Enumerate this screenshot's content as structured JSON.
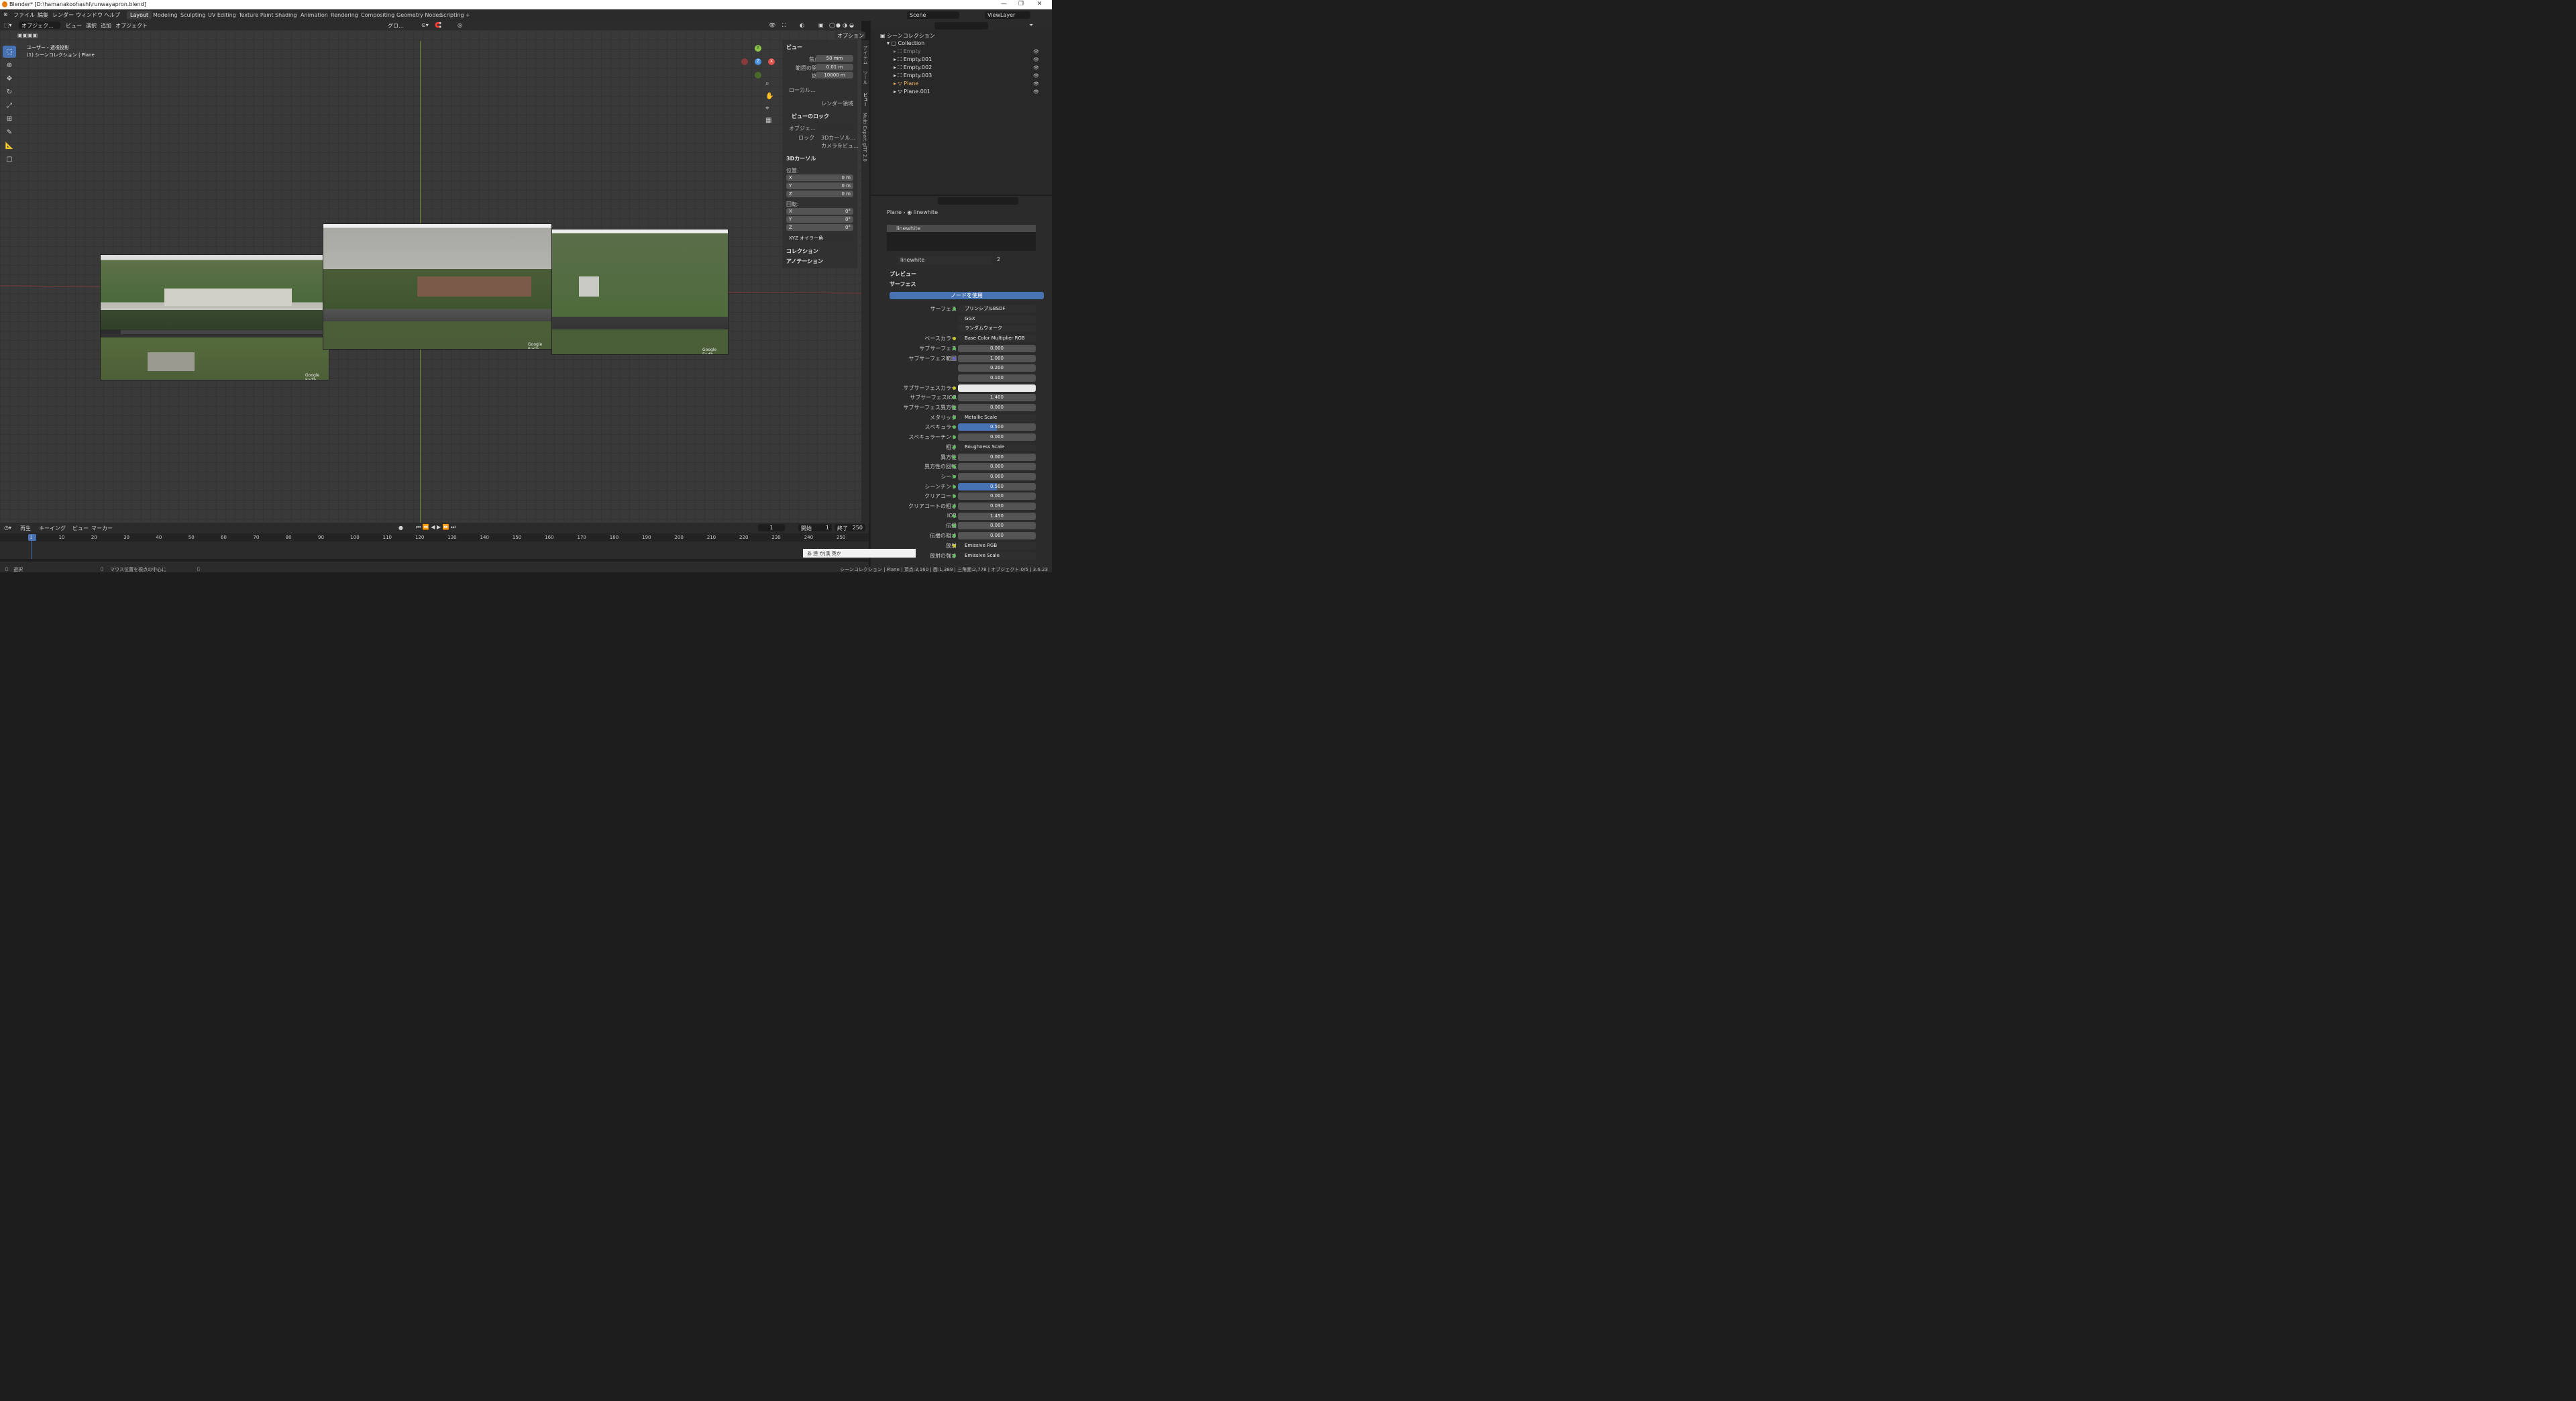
{
  "window": {
    "title": "Blender* [D:\\hamanakoohashi\\runwayapron.blend]"
  },
  "menu": [
    "ファイル",
    "編集",
    "レンダー",
    "ウィンドウ",
    "ヘルプ"
  ],
  "workspaces": [
    "Layout",
    "Modeling",
    "Sculpting",
    "UV Editing",
    "Texture Paint",
    "Shading",
    "Animation",
    "Rendering",
    "Compositing",
    "Geometry Nodes",
    "Scripting"
  ],
  "active_workspace": "Layout",
  "scene": "Scene",
  "viewlayer": "ViewLayer",
  "viewport_header": {
    "mode": "オブジェク…",
    "view": "ビュー",
    "select": "選択",
    "add": "追加",
    "object": "オブジェクト",
    "transform": "グロ…",
    "options": "オプション"
  },
  "viewport": {
    "title": "ユーザー・透視投影",
    "subtitle": "(1) シーンコレクション | Plane",
    "watermark": "Google Earth"
  },
  "npanel": {
    "view_header": "ビュー",
    "focal_label": "焦点距離",
    "focal": "50 mm",
    "clip_start_label": "範囲の開始",
    "clip_start": "0.01 m",
    "clip_end_label": "終了",
    "clip_end": "10000 m",
    "local_label": "ローカル…",
    "render_region": "レンダー領域",
    "view_lock": "ビューのロック",
    "lock_object": "オブジェ…",
    "lock_label": "ロック",
    "lock_cursor": "3Dカーソル…",
    "lock_camera": "カメラをビュ…",
    "cursor_header": "3Dカーソル",
    "location": "位置:",
    "x": "X",
    "y": "Y",
    "z": "Z",
    "loc_x": "0 m",
    "loc_y": "0 m",
    "loc_z": "0 m",
    "rotation": "回転:",
    "rot_x": "0°",
    "rot_y": "0°",
    "rot_z": "0°",
    "euler": "XYZ オイラー角",
    "collection": "コレクション",
    "annotation": "アノテーション"
  },
  "side_tabs": [
    "アイテム",
    "ツール",
    "ビュー",
    "Multi-Export glTF 2.0"
  ],
  "outliner": {
    "root": "シーンコレクション",
    "collection": "Collection",
    "items": [
      "Empty",
      "Empty.001",
      "Empty.002",
      "Empty.003",
      "Plane",
      "Plane.001"
    ]
  },
  "properties": {
    "breadcrumb_obj": "Plane",
    "breadcrumb_mat": "linewhite",
    "slot": "linewhite",
    "material": "linewhite",
    "users": "2",
    "preview": "プレビュー",
    "surface": "サーフェス",
    "use_nodes": "ノードを使用",
    "rows": [
      {
        "label": "サーフェス",
        "value": "プリンシプルBSDF",
        "kind": "link",
        "dot": "g"
      },
      {
        "label": "",
        "value": "GGX",
        "kind": "enum"
      },
      {
        "label": "",
        "value": "ランダムウォーク",
        "kind": "enum"
      },
      {
        "label": "ベースカラー",
        "value": "Base Color Multiplier RGB",
        "kind": "link",
        "dot": "y"
      },
      {
        "label": "サブサーフェス",
        "value": "0.000",
        "kind": "num",
        "dot": "g"
      },
      {
        "label": "サブサーフェス範囲",
        "value": "1.000",
        "kind": "num",
        "dot": "b"
      },
      {
        "label": "",
        "value": "0.200",
        "kind": "num"
      },
      {
        "label": "",
        "value": "0.100",
        "kind": "num"
      },
      {
        "label": "サブサーフェスカラー",
        "value": "",
        "kind": "color",
        "dot": "y"
      },
      {
        "label": "サブサーフェスIOR",
        "value": "1.400",
        "kind": "num",
        "dot": "g"
      },
      {
        "label": "サブサーフェス異方性",
        "value": "0.000",
        "kind": "num",
        "dot": "g"
      },
      {
        "label": "メタリック",
        "value": "Metallic Scale",
        "kind": "link",
        "dot": "g"
      },
      {
        "label": "スペキュラー",
        "value": "0.500",
        "kind": "blue",
        "dot": "g"
      },
      {
        "label": "スペキュラーチント",
        "value": "0.000",
        "kind": "num",
        "dot": "g"
      },
      {
        "label": "粗さ",
        "value": "Roughness Scale",
        "kind": "link",
        "dot": "g"
      },
      {
        "label": "異方性",
        "value": "0.000",
        "kind": "num",
        "dot": "g"
      },
      {
        "label": "異方性の回転",
        "value": "0.000",
        "kind": "num",
        "dot": "g"
      },
      {
        "label": "シーン",
        "value": "0.000",
        "kind": "num",
        "dot": "g"
      },
      {
        "label": "シーンチント",
        "value": "0.500",
        "kind": "blue",
        "dot": "g"
      },
      {
        "label": "クリアコート",
        "value": "0.000",
        "kind": "num",
        "dot": "g"
      },
      {
        "label": "クリアコートの粗さ",
        "value": "0.030",
        "kind": "num",
        "dot": "g"
      },
      {
        "label": "IOR",
        "value": "1.450",
        "kind": "num",
        "dot": "g"
      },
      {
        "label": "伝播",
        "value": "0.000",
        "kind": "num",
        "dot": "g"
      },
      {
        "label": "伝播の粗さ",
        "value": "0.000",
        "kind": "num",
        "dot": "g"
      },
      {
        "label": "放射",
        "value": "Emissive RGB",
        "kind": "link",
        "dot": "y"
      },
      {
        "label": "放射の強さ",
        "value": "Emissive Scale",
        "kind": "link",
        "dot": "g"
      }
    ]
  },
  "timeline": {
    "playback": "再生",
    "keying": "キーイング",
    "view": "ビュー",
    "marker": "マーカー",
    "current": "1",
    "start_label": "開始",
    "start": "1",
    "end_label": "終了",
    "end": "250",
    "ticks": [
      "1",
      "10",
      "20",
      "30",
      "40",
      "50",
      "60",
      "70",
      "80",
      "90",
      "100",
      "110",
      "120",
      "130",
      "140",
      "150",
      "160",
      "170",
      "180",
      "190",
      "200",
      "210",
      "220",
      "230",
      "240",
      "250"
    ]
  },
  "statusbar": {
    "left": "選択",
    "middle": "マウス位置を視点の中心に",
    "right": "シーンコレクション | Plane | 頂点:3,160 | 面:1,389 | 三角面:2,778 | オブジェクト:0/5 | 3.6.23"
  },
  "ime": "あ 連 かJ漢 英か"
}
